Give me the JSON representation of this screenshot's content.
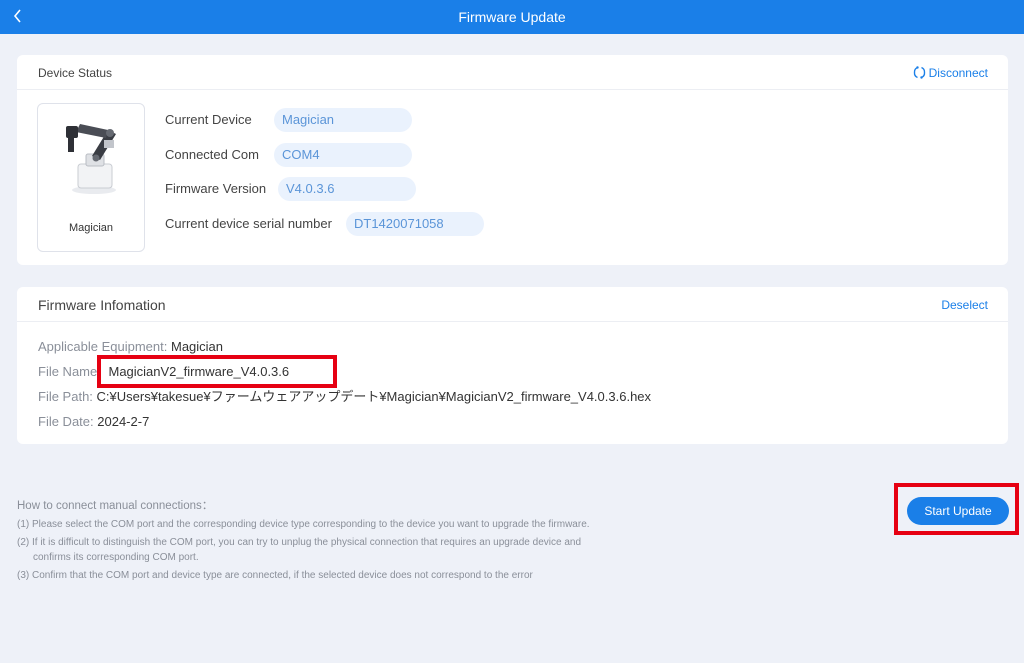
{
  "header": {
    "title": "Firmware Update",
    "back_icon": "chevron-left-icon"
  },
  "device_status": {
    "title": "Device Status",
    "disconnect_label": "Disconnect",
    "device_name": "Magician",
    "rows": [
      {
        "label": "Current Device",
        "value": "Magician"
      },
      {
        "label": "Connected Com",
        "value": "COM4"
      },
      {
        "label": "Firmware Version",
        "value": "V4.0.3.6"
      },
      {
        "label": "Current device serial number",
        "value": "DT1420071058"
      }
    ]
  },
  "firmware_info": {
    "title": "Firmware Infomation",
    "deselect_label": "Deselect",
    "applicable_label": "Applicable Equipment:",
    "applicable_value": "Magician",
    "file_name_label": "File Name:",
    "file_name_value": "MagicianV2_firmware_V4.0.3.6",
    "file_path_label": "File Path:",
    "file_path_value": "C:¥Users¥takesue¥ファームウェアアップデート¥Magician¥MagicianV2_firmware_V4.0.3.6.hex",
    "file_date_label": "File Date:",
    "file_date_value": "2024-2-7"
  },
  "help": {
    "title": "How to connect manual connections：",
    "item1": "(1) Please select the COM port and the corresponding device type corresponding to the device you want to upgrade the firmware.",
    "item2a": "(2) If it is difficult to distinguish the COM port, you can try to unplug the physical connection that requires an upgrade device and",
    "item2b": "confirms its corresponding COM port.",
    "item3": "(3) Confirm that the COM port and device type are connected, if the selected device does not correspond to the error"
  },
  "actions": {
    "start_update_label": "Start Update"
  },
  "colors": {
    "accent": "#1a7fe8",
    "highlight": "#e60012",
    "background": "#eef1f8"
  }
}
